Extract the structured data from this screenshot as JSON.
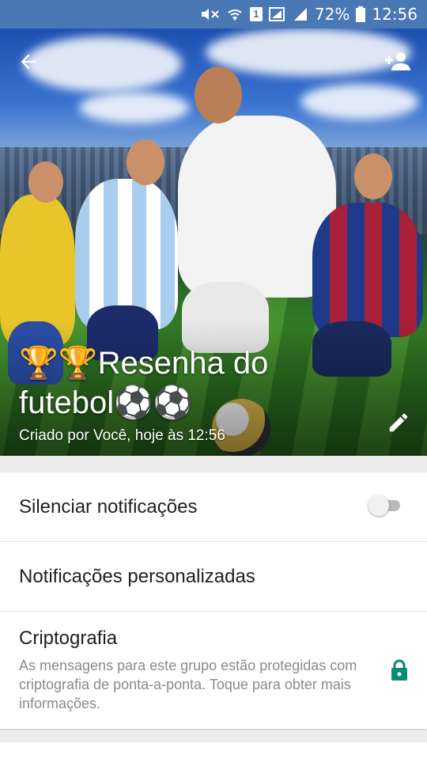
{
  "status_bar": {
    "sim_label": "1",
    "battery_percent": "72%",
    "time": "12:56"
  },
  "group": {
    "title_line1": "🏆🏆Resenha do",
    "title_line2": "futebol⚽⚽",
    "created_by": "Criado por Você, hoje às 12:56"
  },
  "settings": {
    "mute_label": "Silenciar notificações",
    "mute_enabled": false,
    "custom_notifications_label": "Notificações personalizadas",
    "encryption_title": "Criptografia",
    "encryption_desc": "As mensagens para este grupo estão protegidas com criptografia de ponta-a-ponta. Toque para obter mais informações."
  },
  "colors": {
    "status_bar": "#4a78b4",
    "lock_green": "#0a8a6e"
  }
}
